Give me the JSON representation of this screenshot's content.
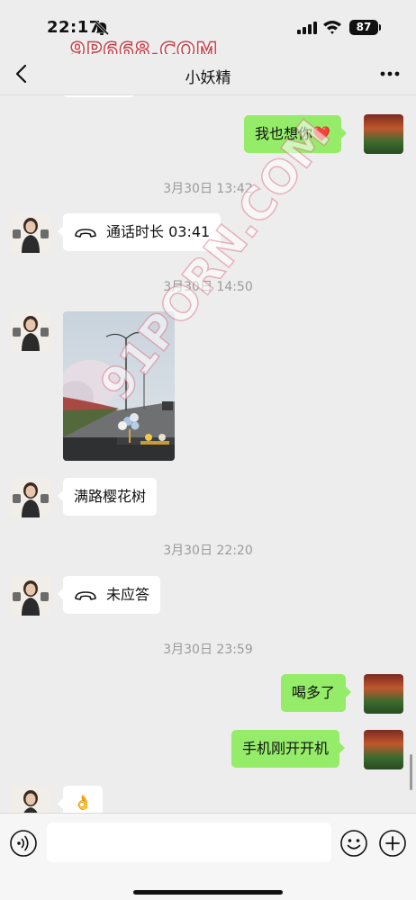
{
  "status_bar": {
    "time": "22:17",
    "battery": "87"
  },
  "watermarks": {
    "top": "9P668.COM",
    "diagonal": "91PORN.COM"
  },
  "header": {
    "title": "小妖精"
  },
  "messages": {
    "m1": {
      "text": "我也想你",
      "emoji": "❤️"
    },
    "ts1": "3月30日 13:42",
    "m2": {
      "text": "通话时长 03:41"
    },
    "ts2": "3月30日 14:50",
    "m4": {
      "text": "满路樱花树"
    },
    "ts3": "3月30日 22:20",
    "m5": {
      "text": "未应答"
    },
    "ts4": "3月30日 23:59",
    "m6": {
      "text": "喝多了"
    },
    "m7": {
      "text": "手机刚开开机"
    },
    "m8": {
      "text": "👌"
    }
  },
  "colors": {
    "outgoing_bubble": "#95ec69",
    "incoming_bubble": "#ffffff",
    "background": "#ededed"
  }
}
